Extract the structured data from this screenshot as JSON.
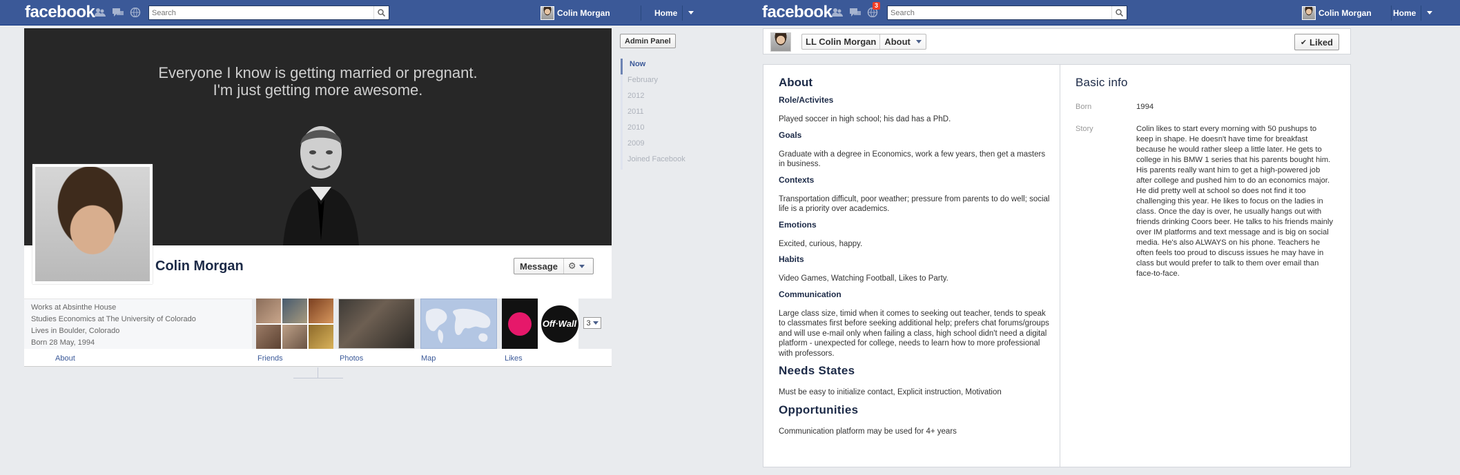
{
  "left": {
    "topbar": {
      "logo": "facebook",
      "search_placeholder": "Search",
      "user_name": "Colin Morgan",
      "home_label": "Home"
    },
    "cover_quote": [
      "Everyone I know is getting married or pregnant.",
      "I'm just getting more awesome."
    ],
    "profile_name": "Colin Morgan",
    "message_label": "Message",
    "info": [
      "Works at Absinthe House",
      "Studies Economics at The University of Colorado",
      "Lives in Boulder, Colorado",
      "Born 28 May, 1994"
    ],
    "likes_tile": {
      "badge_text": "Off·Wall"
    },
    "tabs": {
      "about": "About",
      "friends": "Friends",
      "photos": "Photos",
      "map": "Map",
      "likes": "Likes"
    },
    "more_apps_count": "3",
    "admin_panel_label": "Admin Panel",
    "timeline": [
      "Now",
      "February",
      "2012",
      "2011",
      "2010",
      "2009",
      "Joined Facebook"
    ]
  },
  "right": {
    "topbar": {
      "logo": "facebook",
      "notification_count": "3",
      "search_placeholder": "Search",
      "user_name": "Colin Morgan",
      "home_label": "Home"
    },
    "page_name": "LL Colin Morgan",
    "section_label": "About",
    "liked_label": "Liked",
    "about": {
      "title": "About",
      "sections": [
        {
          "heading": "Role/Activites",
          "text": "Played soccer in high school; his dad has a PhD."
        },
        {
          "heading": "Goals",
          "text": "Graduate with a degree in Economics, work a few years, then get a masters in business."
        },
        {
          "heading": "Contexts",
          "text": "Transportation difficult, poor weather; pressure from parents to do well; social life is a priority over academics."
        },
        {
          "heading": "Emotions",
          "text": "Excited, curious, happy."
        },
        {
          "heading": "Habits",
          "text": "Video Games, Watching Football, Likes to Party."
        },
        {
          "heading": "Communication",
          "text": "Large class size, timid when it comes to seeking out teacher, tends to speak to classmates first before seeking additional help; prefers chat forums/groups and will use e-mail only when failing a class, high school didn't need a digital platform - unexpected for college, needs to learn how to more professional with professors."
        }
      ],
      "needs_states_title": "Needs States",
      "needs_states_text": "Must be easy to initialize contact, Explicit instruction, Motivation",
      "opportunities_title": "Opportunities",
      "opportunities_text": "Communication platform may be used for 4+ years"
    },
    "basic_info": {
      "title": "Basic info",
      "born_label": "Born",
      "born_value": "1994",
      "story_label": "Story",
      "story_value": "Colin likes to start every morning with 50 pushups to keep in shape. He doesn't have time for breakfast because he would rather sleep a little later. He gets to college in his BMW 1 series that his parents bought him. His parents really want him to get a high-powered job after college and pushed him to do an economics major. He did pretty well at school so does not find it too challenging this year. He likes to focus on the ladies in class. Once the day is over, he usually hangs out with friends drinking Coors beer. He talks to his friends mainly over IM platforms and text message and is big on social media. He's also ALWAYS on his phone. Teachers he often feels too proud to discuss issues he may have in class but would prefer to talk to them over email than face-to-face."
    }
  },
  "icons": [
    "friends-icon",
    "messages-icon",
    "globe-icon",
    "search-icon",
    "gear-icon",
    "check-icon",
    "caret-down-icon"
  ],
  "colors": {
    "brand_blue": "#3b5998",
    "notification_red": "#f03d25"
  }
}
